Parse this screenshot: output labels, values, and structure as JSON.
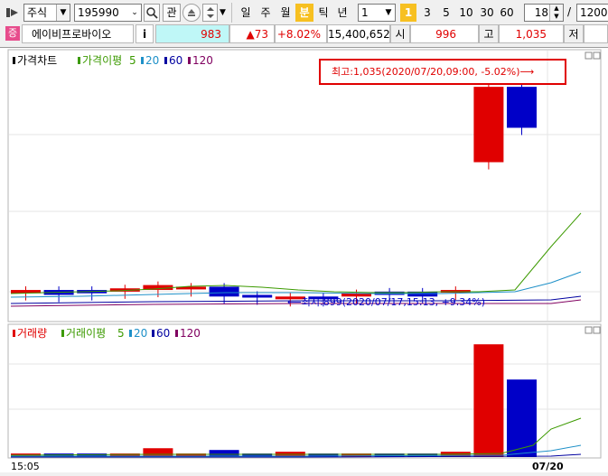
{
  "toolbar": {
    "market": "주식",
    "code": "195990",
    "search_icon": "magnifier-icon",
    "watch_label": "관",
    "periods": [
      "일",
      "주",
      "월",
      "분",
      "틱",
      "년"
    ],
    "active_period": "분",
    "interval_value": "1",
    "minute_buttons": [
      "1",
      "3",
      "5",
      "10",
      "30",
      "60"
    ],
    "active_minute": "1",
    "count_value": "18",
    "slash": "/",
    "total_value": "1200"
  },
  "info": {
    "badge": "증",
    "name": "에이비프로바이오",
    "info_button": "i",
    "price": "983",
    "change": "▲73",
    "change_pct": "+8.02%",
    "volume": "15,400,652",
    "open_label": "시",
    "open_value": "996",
    "high_label": "고",
    "high_value": "1,035",
    "low_label": "저"
  },
  "price_panel": {
    "legend_title": "가격차트",
    "ma_label": "가격이평",
    "ma_periods": [
      "5",
      "20",
      "60",
      "120"
    ],
    "high_annotation": "최고:1,035(2020/07/20,09:00, -5.02%)⟶",
    "low_annotation": "⟵최저:899(2020/07/17,15:13, +9.34%)"
  },
  "volume_panel": {
    "legend_title": "거래량",
    "ma_label": "거래이평",
    "ma_periods": [
      "5",
      "20",
      "60",
      "120"
    ]
  },
  "x_axis": {
    "left_label": "15:05",
    "date_label": "07/20"
  },
  "colors": {
    "up": "#e00000",
    "down": "#0000c8",
    "ma5": "#3c9a00",
    "ma20": "#1e90c8",
    "ma60": "#0000a0",
    "ma120": "#800060",
    "accent": "#f7c021",
    "highlight_box": "#e00000"
  },
  "chart_data": {
    "type": "candlestick",
    "candles": [
      {
        "dir": "up",
        "open": 904,
        "close": 906
      },
      {
        "dir": "down",
        "open": 906,
        "close": 903
      },
      {
        "dir": "down",
        "open": 906,
        "close": 904
      },
      {
        "dir": "up",
        "open": 905,
        "close": 907
      },
      {
        "dir": "up",
        "open": 906,
        "close": 909
      },
      {
        "dir": "up",
        "open": 907,
        "close": 908
      },
      {
        "dir": "down",
        "open": 908,
        "close": 902
      },
      {
        "dir": "down",
        "open": 903,
        "close": 902
      },
      {
        "dir": "up",
        "open": 901,
        "close": 902
      },
      {
        "dir": "down",
        "open": 902,
        "close": 901
      },
      {
        "dir": "up",
        "open": 902,
        "close": 904
      },
      {
        "dir": "down",
        "open": 905,
        "close": 903
      },
      {
        "dir": "down",
        "open": 905,
        "close": 902
      },
      {
        "dir": "up",
        "open": 906,
        "close": 906
      },
      {
        "dir": "up",
        "open": 984,
        "close": 1030
      },
      {
        "dir": "down",
        "open": 1030,
        "close": 1005
      }
    ],
    "volumes": [
      2,
      2,
      2,
      2,
      5,
      2,
      4,
      2,
      3,
      2,
      2,
      2,
      2,
      3,
      12,
      64
    ],
    "volume_last": 44
  }
}
